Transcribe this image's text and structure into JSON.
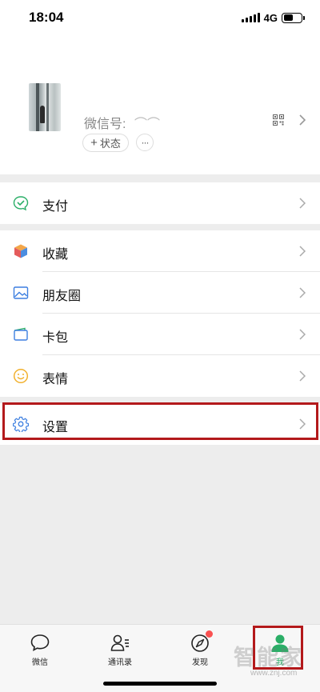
{
  "status_bar": {
    "time": "18:04",
    "network": "4G"
  },
  "profile": {
    "wechat_id_label": "微信号:",
    "wechat_id_value": "⌒⌒",
    "status_button_label": "状态",
    "status_button_plus": "+",
    "more_button_label": "···"
  },
  "menu": {
    "pay": "支付",
    "favorites": "收藏",
    "moments": "朋友圈",
    "cards": "卡包",
    "stickers": "表情",
    "settings": "设置"
  },
  "tabs": [
    {
      "label": "微信",
      "icon": "chat-bubble-icon"
    },
    {
      "label": "通讯录",
      "icon": "contacts-icon"
    },
    {
      "label": "发现",
      "icon": "compass-icon",
      "badge": true
    },
    {
      "label": "我",
      "icon": "me-icon",
      "active": true
    }
  ],
  "watermark": {
    "text": "智能家",
    "url": "www.znj.com"
  },
  "colors": {
    "accent": "#2aae67",
    "highlight": "#b3191b",
    "badge": "#fa5151"
  }
}
